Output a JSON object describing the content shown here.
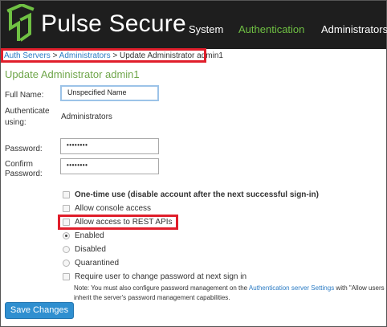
{
  "header": {
    "logo_text": "Pulse Secure",
    "nav": [
      "System",
      "Authentication",
      "Administrators"
    ],
    "active_nav": "Authentication"
  },
  "breadcrumb": {
    "items": [
      "Auth Servers",
      "Administrators"
    ],
    "separator": ">",
    "current": "Update Administrator admin1"
  },
  "page_title": "Update Administrator admin1",
  "form": {
    "full_name_label": "Full Name:",
    "full_name_value": "Unspecified Name",
    "authenticate_label_1": "Authenticate",
    "authenticate_label_2": "using:",
    "authenticate_value": "Administrators",
    "password_label": "Password:",
    "password_value": "••••••••",
    "confirm_label_1": "Confirm",
    "confirm_label_2": "Password:",
    "confirm_value": "••••••••"
  },
  "options": {
    "one_time_use": "One-time use (disable account after the next successful sign-in)",
    "allow_console": "Allow console access",
    "allow_rest": "Allow access to REST APIs",
    "enabled": "Enabled",
    "disabled": "Disabled",
    "quarantined": "Quarantined",
    "require_change": "Require user to change password at next sign in",
    "selected_status": "Enabled"
  },
  "note": {
    "prefix": "Note: You must also configure password management on the ",
    "link": "Authentication server Settings",
    "suffix": " with \"Allow users",
    "line2": "inherit the server's password management capabilities."
  },
  "save_button": "Save Changes",
  "colors": {
    "header_bg": "#1e1e1e",
    "brand_green": "#6fc043",
    "link_blue": "#2a7bc4",
    "title_green": "#6fa64a",
    "highlight_red": "#e01e2b",
    "button_blue": "#2f8fd0"
  },
  "icons": [
    "pulse-secure-logo-icon"
  ]
}
